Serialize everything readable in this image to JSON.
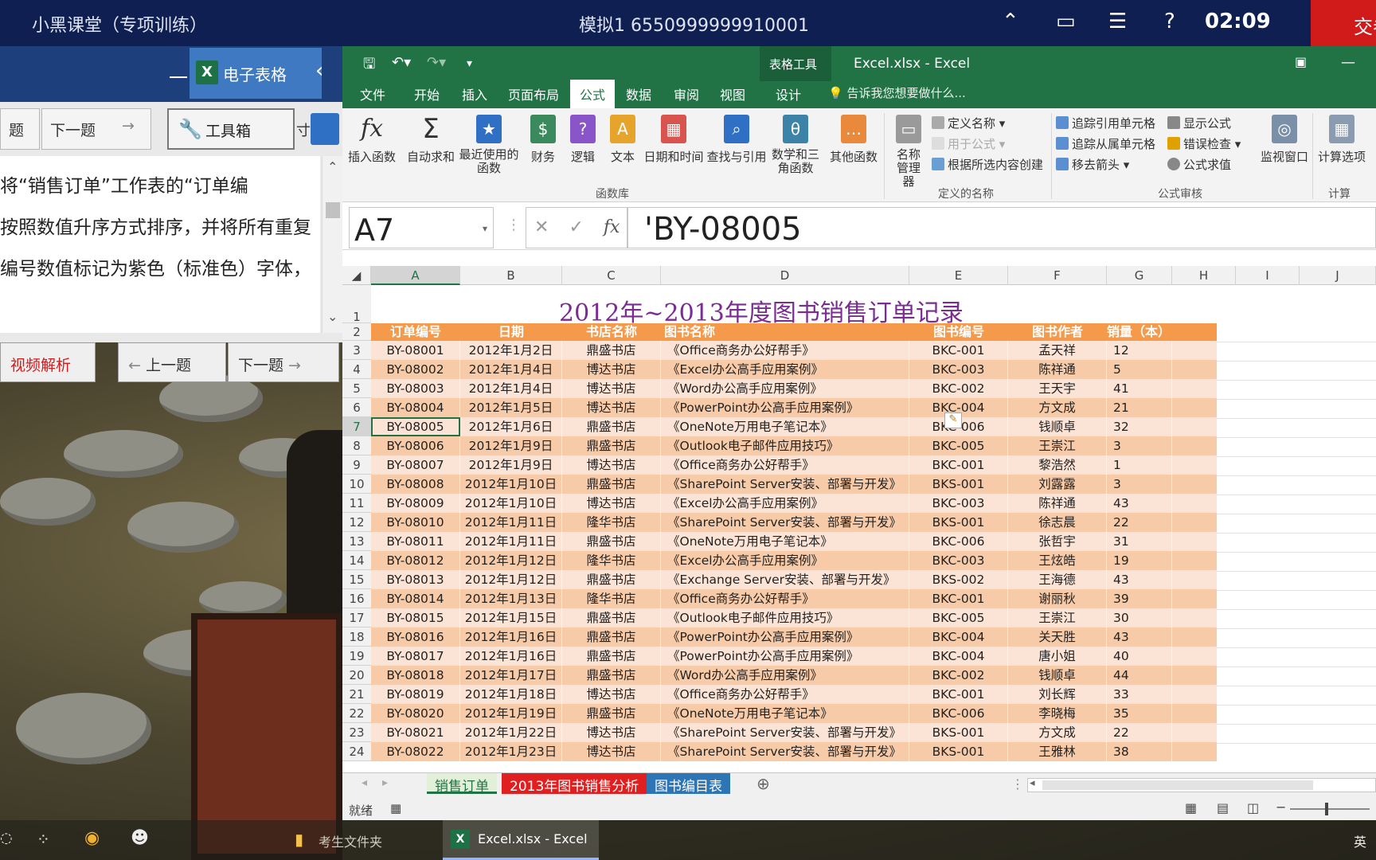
{
  "topbar": {
    "app_title": "小黑课堂（专项训练）",
    "exam_id": "模拟1  6550999999910001",
    "time": "02:09",
    "submit_label": "交卷"
  },
  "question_panel": {
    "dash": "一",
    "app_tab_label": "电子表格",
    "nav_prev_partial": "题",
    "nav_next": "下一题",
    "toolbox_label": "工具箱",
    "toolbox_extra": "寸",
    "question_lines": [
      "将“销售订单”工作表的“订单编",
      "按照数值升序方式排序，并将所有重复",
      "编号数值标记为紫色（标准色）字体，"
    ],
    "video_label": "视频解析",
    "prev_label": "上一题",
    "next_label": "下一题"
  },
  "excel": {
    "doc_title": "Excel.xlsx - Excel",
    "context_tab": "表格工具",
    "ribbon_tabs": [
      "文件",
      "开始",
      "插入",
      "页面布局",
      "公式",
      "数据",
      "审阅",
      "视图",
      "设计"
    ],
    "active_tab": "公式",
    "tell_me": "告诉我您想要做什么...",
    "ribbon_buttons": [
      {
        "label": "插入函数",
        "icon": "fx"
      },
      {
        "label": "自动求和",
        "icon": "Σ"
      },
      {
        "label": "最近使用的函数",
        "icon": "★"
      },
      {
        "label": "财务",
        "icon": "$"
      },
      {
        "label": "逻辑",
        "icon": "?"
      },
      {
        "label": "文本",
        "icon": "A"
      },
      {
        "label": "日期和时间",
        "icon": "▦"
      },
      {
        "label": "查找与引用",
        "icon": "⌕"
      },
      {
        "label": "数学和三角函数",
        "icon": "θ"
      },
      {
        "label": "其他函数",
        "icon": "…"
      },
      {
        "label": "名称管理器",
        "icon": "▭"
      },
      {
        "label": "监视窗口",
        "icon": "◎"
      },
      {
        "label": "计算选项",
        "icon": "▦"
      }
    ],
    "small_buttons": {
      "define_name": "定义名称",
      "use_in_formula": "用于公式",
      "create_from_sel": "根据所选内容创建",
      "trace_precedents": "追踪引用单元格",
      "trace_dependents": "追踪从属单元格",
      "remove_arrows": "移去箭头",
      "show_formulas": "显示公式",
      "error_check": "错误检查",
      "evaluate": "公式求值"
    },
    "group_labels": {
      "library": "函数库",
      "names": "定义的名称",
      "audit": "公式审核",
      "calc": "计算"
    },
    "name_box": "A7",
    "formula": "'BY-08005",
    "columns": [
      "A",
      "B",
      "C",
      "D",
      "E",
      "F",
      "G",
      "H",
      "I",
      "J"
    ],
    "selected_column": "A",
    "sheet_title": "2012年~2013年度图书销售订单记录",
    "headers": [
      "订单编号",
      "日期",
      "书店名称",
      "图书名称",
      "图书编号",
      "图书作者",
      "销量（本）"
    ],
    "rows": [
      [
        "BY-08001",
        "2012年1月2日",
        "鼎盛书店",
        "《Office商务办公好帮手》",
        "BKC-001",
        "孟天祥",
        "12"
      ],
      [
        "BY-08002",
        "2012年1月4日",
        "博达书店",
        "《Excel办公高手应用案例》",
        "BKC-003",
        "陈祥通",
        "5"
      ],
      [
        "BY-08003",
        "2012年1月4日",
        "博达书店",
        "《Word办公高手应用案例》",
        "BKC-002",
        "王天宇",
        "41"
      ],
      [
        "BY-08004",
        "2012年1月5日",
        "博达书店",
        "《PowerPoint办公高手应用案例》",
        "BKC-004",
        "方文成",
        "21"
      ],
      [
        "BY-08005",
        "2012年1月6日",
        "鼎盛书店",
        "《OneNote万用电子笔记本》",
        "BKC-006",
        "钱顺卓",
        "32"
      ],
      [
        "BY-08006",
        "2012年1月9日",
        "鼎盛书店",
        "《Outlook电子邮件应用技巧》",
        "BKC-005",
        "王崇江",
        "3"
      ],
      [
        "BY-08007",
        "2012年1月9日",
        "博达书店",
        "《Office商务办公好帮手》",
        "BKC-001",
        "黎浩然",
        "1"
      ],
      [
        "BY-08008",
        "2012年1月10日",
        "鼎盛书店",
        "《SharePoint Server安装、部署与开发》",
        "BKS-001",
        "刘露露",
        "3"
      ],
      [
        "BY-08009",
        "2012年1月10日",
        "博达书店",
        "《Excel办公高手应用案例》",
        "BKC-003",
        "陈祥通",
        "43"
      ],
      [
        "BY-08010",
        "2012年1月11日",
        "隆华书店",
        "《SharePoint Server安装、部署与开发》",
        "BKS-001",
        "徐志晨",
        "22"
      ],
      [
        "BY-08011",
        "2012年1月11日",
        "鼎盛书店",
        "《OneNote万用电子笔记本》",
        "BKC-006",
        "张哲宇",
        "31"
      ],
      [
        "BY-08012",
        "2012年1月12日",
        "隆华书店",
        "《Excel办公高手应用案例》",
        "BKC-003",
        "王炫皓",
        "19"
      ],
      [
        "BY-08013",
        "2012年1月12日",
        "鼎盛书店",
        "《Exchange Server安装、部署与开发》",
        "BKS-002",
        "王海德",
        "43"
      ],
      [
        "BY-08014",
        "2012年1月13日",
        "隆华书店",
        "《Office商务办公好帮手》",
        "BKC-001",
        "谢丽秋",
        "39"
      ],
      [
        "BY-08015",
        "2012年1月15日",
        "鼎盛书店",
        "《Outlook电子邮件应用技巧》",
        "BKC-005",
        "王崇江",
        "30"
      ],
      [
        "BY-08016",
        "2012年1月16日",
        "鼎盛书店",
        "《PowerPoint办公高手应用案例》",
        "BKC-004",
        "关天胜",
        "43"
      ],
      [
        "BY-08017",
        "2012年1月16日",
        "鼎盛书店",
        "《PowerPoint办公高手应用案例》",
        "BKC-004",
        "唐小姐",
        "40"
      ],
      [
        "BY-08018",
        "2012年1月17日",
        "鼎盛书店",
        "《Word办公高手应用案例》",
        "BKC-002",
        "钱顺卓",
        "44"
      ],
      [
        "BY-08019",
        "2012年1月18日",
        "博达书店",
        "《Office商务办公好帮手》",
        "BKC-001",
        "刘长辉",
        "33"
      ],
      [
        "BY-08020",
        "2012年1月19日",
        "鼎盛书店",
        "《OneNote万用电子笔记本》",
        "BKC-006",
        "李晓梅",
        "35"
      ],
      [
        "BY-08021",
        "2012年1月22日",
        "博达书店",
        "《SharePoint Server安装、部署与开发》",
        "BKS-001",
        "方文成",
        "22"
      ],
      [
        "BY-08022",
        "2012年1月23日",
        "博达书店",
        "《SharePoint Server安装、部署与开发》",
        "BKS-001",
        "王雅林",
        "38"
      ]
    ],
    "row_numbers": [
      "1",
      "2",
      "3",
      "4",
      "5",
      "6",
      "7",
      "8",
      "9",
      "10",
      "11",
      "12",
      "13",
      "14",
      "15",
      "16",
      "17",
      "18",
      "19",
      "20",
      "21",
      "22",
      "23",
      "24"
    ],
    "selected_row": "7",
    "sheet_tabs": [
      {
        "label": "销售订单",
        "color": "#e2f0d9",
        "text": "#217346"
      },
      {
        "label": "2013年图书销售分析",
        "color": "#e02020",
        "text": "#ffffff"
      },
      {
        "label": "图书编目表",
        "color": "#2e75b6",
        "text": "#ffffff"
      }
    ],
    "status": "就绪"
  },
  "taskbar": {
    "folder_label": "考生文件夹",
    "excel_label": "Excel.xlsx - Excel",
    "ime": "英"
  },
  "colors": {
    "excel_green": "#217346",
    "header_orange": "#f59a4b",
    "title_purple": "#7b2c93",
    "topbar_navy": "#0f1f52"
  }
}
